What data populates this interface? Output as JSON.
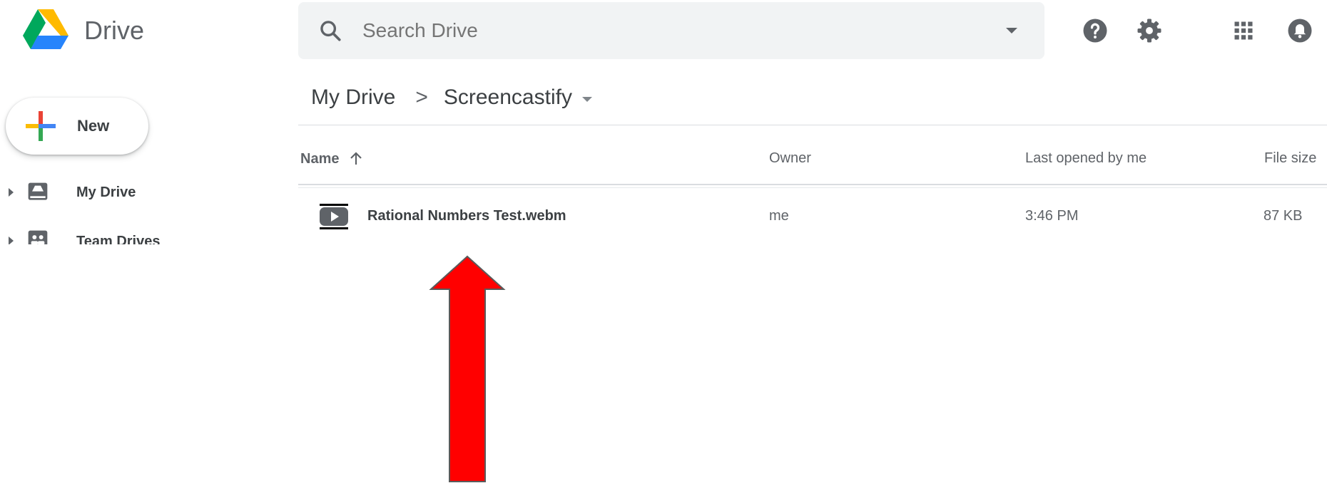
{
  "app": {
    "name": "Drive"
  },
  "search": {
    "placeholder": "Search Drive"
  },
  "sidebar": {
    "new_label": "New",
    "items": [
      {
        "label": "My Drive",
        "icon": "my-drive-icon"
      },
      {
        "label": "Team Drives",
        "icon": "team-drives-icon"
      }
    ]
  },
  "breadcrumb": {
    "root": "My Drive",
    "separator": ">",
    "current": "Screencastify"
  },
  "table": {
    "columns": {
      "name": "Name",
      "owner": "Owner",
      "last_opened": "Last opened by me",
      "file_size": "File size"
    },
    "sort": "ascending",
    "rows": [
      {
        "name": "Rational Numbers Test.webm",
        "owner": "me",
        "last_opened": "3:46 PM",
        "file_size": "87 KB",
        "icon": "video-file-icon"
      }
    ]
  },
  "top_icons": [
    "help-icon",
    "settings-icon",
    "apps-grid-icon",
    "notifications-icon"
  ],
  "colors": {
    "accent_arrow": "#ff0000",
    "search_bg": "#f1f3f4",
    "text_secondary": "#5f6368"
  }
}
